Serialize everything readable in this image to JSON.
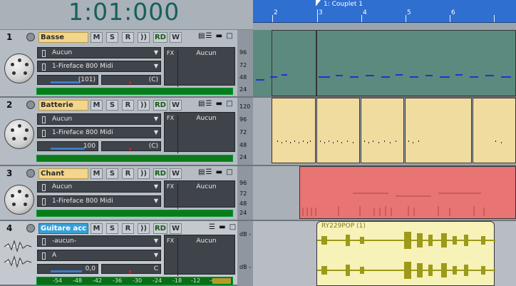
{
  "transport": {
    "time": "1:01:000"
  },
  "timeline": {
    "marker_label": "1: Couplet 1",
    "bar_numbers": [
      "2",
      "3",
      "4",
      "5",
      "6"
    ]
  },
  "tracks": [
    {
      "number": "1",
      "name": "Basse",
      "input": "Aucun",
      "output": "1-Fireface 800 Midi",
      "volume": "(101)",
      "pan": "(C)",
      "fx": "FX",
      "fx_value": "Aucun",
      "scale": [
        "96",
        "72",
        "48",
        "24"
      ],
      "buttons": [
        "M",
        "S",
        "R",
        "RD",
        "W"
      ]
    },
    {
      "number": "2",
      "name": "Batterie",
      "input": "Aucun",
      "output": "1-Fireface 800 Midi",
      "volume": "100",
      "pan": "(C)",
      "fx": "FX",
      "fx_value": "Aucun",
      "scale": [
        "120",
        "96",
        "72",
        "48",
        "24"
      ],
      "buttons": [
        "M",
        "S",
        "R",
        "RD",
        "W"
      ]
    },
    {
      "number": "3",
      "name": "Chant",
      "input": "Aucun",
      "output": "1-Fireface 800 Midi",
      "volume": "",
      "pan": "",
      "fx": "FX",
      "fx_value": "Aucun",
      "scale": [
        "96",
        "72",
        "48",
        "24"
      ],
      "buttons": [
        "M",
        "S",
        "R",
        "RD",
        "W"
      ]
    },
    {
      "number": "4",
      "name": "Guitare acc",
      "input": "-aucun-",
      "output": "A",
      "volume": "0,0",
      "pan": "C",
      "fx": "FX",
      "fx_value": "Aucun",
      "scale": [
        "dB -",
        "dB -"
      ],
      "buttons": [
        "M",
        "S",
        "R",
        "RD",
        "W"
      ],
      "meter_ticks": [
        "-54",
        "-48",
        "-42",
        "-36",
        "-30",
        "-24",
        "-18",
        "-12",
        "-6"
      ]
    }
  ],
  "clips": {
    "audio_clip_label": "RY229POP (1)"
  },
  "colors": {
    "ruler": "#2f6fd0",
    "basse_clip": "#5c8a7e",
    "batterie_clip": "#f1dca0",
    "chant_clip": "#e87474",
    "audio_clip": "#f7f2b8",
    "track_name": "#f3d58b",
    "selected_name": "#3aa0d8",
    "meter": "#0c7a19"
  }
}
